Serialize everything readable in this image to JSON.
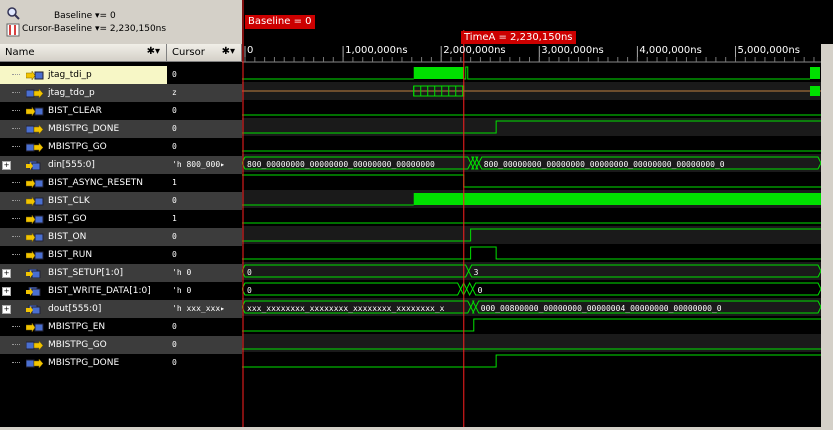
{
  "toolbar": {
    "baseline_label": "Baseline ▾= 0",
    "cursor_baseline_label": "Cursor-Baseline ▾= 2,230,150ns"
  },
  "columns": {
    "name_header": "Name",
    "cursor_header": "Cursor"
  },
  "signals": [
    {
      "name": "jtag_tdi_p",
      "value": "0",
      "type": "in",
      "selected": true
    },
    {
      "name": "jtag_tdo_p",
      "value": "z",
      "type": "out"
    },
    {
      "name": "BIST_CLEAR",
      "value": "0",
      "type": "in"
    },
    {
      "name": "MBISTPG_DONE",
      "value": "0",
      "type": "out"
    },
    {
      "name": "MBISTPG_GO",
      "value": "0",
      "type": "out"
    },
    {
      "name": "din[555:0]",
      "value": "'h 800_000▸",
      "type": "bus"
    },
    {
      "name": "BIST_ASYNC_RESETN",
      "value": "1",
      "type": "in"
    },
    {
      "name": "BIST_CLK",
      "value": "0",
      "type": "in"
    },
    {
      "name": "BIST_GO",
      "value": "1",
      "type": "in"
    },
    {
      "name": "BIST_ON",
      "value": "0",
      "type": "in"
    },
    {
      "name": "BIST_RUN",
      "value": "0",
      "type": "in"
    },
    {
      "name": "BIST_SETUP[1:0]",
      "value": "'h 0",
      "type": "bus"
    },
    {
      "name": "BIST_WRITE_DATA[1:0]",
      "value": "'h 0",
      "type": "bus"
    },
    {
      "name": "dout[555:0]",
      "value": "'h xxx_xxx▸",
      "type": "bus"
    },
    {
      "name": "MBISTPG_EN",
      "value": "0",
      "type": "in"
    },
    {
      "name": "MBISTPG_GO",
      "value": "0",
      "type": "out"
    },
    {
      "name": "MBISTPG_DONE",
      "value": "0",
      "type": "out"
    }
  ],
  "timeline": {
    "baseline_tag": "Baseline = 0",
    "cursor_tag": "TimeA = 2,230,150ns",
    "ticks": [
      "0",
      "1,000,000ns",
      "2,000,000ns",
      "3,000,000ns",
      "4,000,000ns",
      "5,000,000ns"
    ]
  },
  "bus_values": {
    "din_left": "800_00000000_00000000_00000000_00000000",
    "din_right": "800_00000000_00000000_00000000_00000000_00000000_0",
    "setup_left": "0",
    "setup_right": "3",
    "wdata_left": "0",
    "wdata_right": "0",
    "dout_left": "xxx_xxxxxxxx_xxxxxxxx_xxxxxxxx_xxxxxxxx_x",
    "dout_right": "000_00800000_00000000_00000004_00000000_00000000_0"
  },
  "colors": {
    "wave": "#00e000",
    "cursor": "#ff2020",
    "tag": "#cc0000"
  }
}
